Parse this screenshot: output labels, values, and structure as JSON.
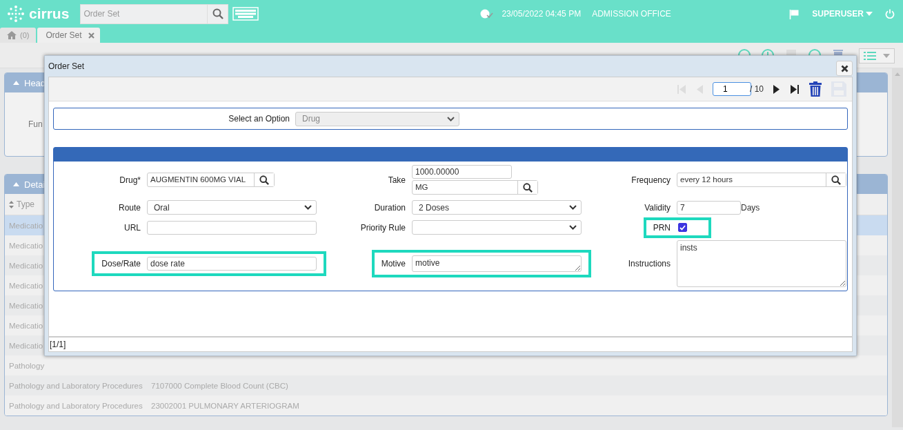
{
  "header": {
    "logo": "cirrus",
    "search": {
      "placeholder": "Order Set"
    },
    "datetime": "23/05/2022 04:45 PM",
    "location": "ADMISSION OFFICE",
    "user": "SUPERUSER"
  },
  "tabs": [
    {
      "kind": "home",
      "label": "(0)",
      "selected": false
    },
    {
      "kind": "page",
      "label": "Order Set",
      "selected": true
    }
  ],
  "background": {
    "header_panel": {
      "title": "Head",
      "field_label": "Fun"
    },
    "details_panel": {
      "title": "Detai",
      "column_1": "Type",
      "rows": [
        {
          "type": "Medicatio",
          "selected": true
        },
        {
          "type": "Medicatio",
          "selected": false
        },
        {
          "type": "Medicatio",
          "selected": false
        },
        {
          "type": "Medicatio",
          "selected": false
        },
        {
          "type": "Medicatio",
          "selected": false
        },
        {
          "type": "Medicatio",
          "selected": false
        },
        {
          "type": "Medicatio",
          "selected": false
        },
        {
          "type": "Pathology",
          "selected": false
        },
        {
          "type": "Pathology and Laboratory Procedures",
          "procedure": "7107000 Complete Blood Count (CBC)",
          "selected": false
        },
        {
          "type": "Pathology and Laboratory Procedures",
          "procedure": "23002001 PULMONARY ARTERIOGRAM",
          "selected": false
        }
      ]
    }
  },
  "modal": {
    "title": "Order Set",
    "pager_buttons": [
      {
        "kind": "first",
        "disabled": true
      },
      {
        "kind": "prev",
        "disabled": true
      },
      {
        "kind": "page",
        "value": "1",
        "total": "/ 10"
      },
      {
        "kind": "next",
        "disabled": false
      },
      {
        "kind": "last",
        "disabled": false
      },
      {
        "kind": "delete",
        "disabled": false
      },
      {
        "kind": "save",
        "disabled": true
      }
    ],
    "option": {
      "label": "Select an Option",
      "value": "Drug",
      "disabled": true
    },
    "form": {
      "rows": [
        [
          {
            "label": "Drug*",
            "kind": "lookup",
            "value": "AUGMENTIN 600MG VIAL",
            "highlighted": false
          },
          {
            "label": "Take",
            "kind": "amount",
            "value": "1000.00000",
            "unit": "MG",
            "highlighted": false
          },
          {
            "label": "Frequency",
            "kind": "lookup",
            "value": "every 12 hours",
            "highlighted": false
          }
        ],
        [
          {
            "label": "Route",
            "kind": "select",
            "value": "Oral",
            "highlighted": false
          },
          {
            "label": "Duration",
            "kind": "select",
            "value": "2 Doses",
            "highlighted": false
          },
          {
            "label": "Validity",
            "kind": "suffix",
            "value": "7",
            "suffix": "Days",
            "highlighted": false
          }
        ],
        [
          {
            "label": "URL",
            "kind": "text",
            "highlighted": false
          },
          {
            "label": "Priority Rule",
            "kind": "select",
            "highlighted": false
          },
          {
            "label": "PRN",
            "kind": "checkbox",
            "checked": true,
            "highlighted": true
          }
        ],
        [
          {
            "label": "Dose/Rate",
            "kind": "text",
            "value": "dose rate",
            "highlighted": true
          },
          {
            "label": "Motive",
            "kind": "memo",
            "value": "motive",
            "highlighted": true
          },
          {
            "label": "Instructions",
            "kind": "textarea",
            "value": "insts",
            "highlighted": false
          }
        ]
      ]
    },
    "footer": "[1/1]"
  }
}
